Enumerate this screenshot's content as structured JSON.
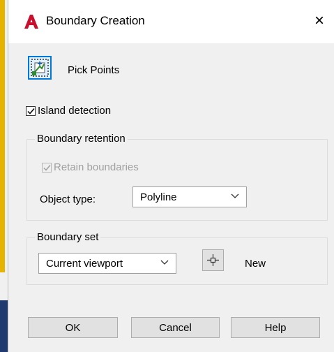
{
  "window": {
    "title": "Boundary Creation",
    "close_glyph": "×",
    "logo_letter": "A",
    "logo_color": "#c8102e"
  },
  "pick_points": {
    "label": "Pick Points",
    "icon": "pick-points-icon"
  },
  "island_detection": {
    "label": "Island detection",
    "checked": true
  },
  "boundary_retention": {
    "title": "Boundary retention",
    "retain": {
      "label": "Retain boundaries",
      "checked": true,
      "enabled": false
    },
    "object_type": {
      "label": "Object type:",
      "value": "Polyline"
    }
  },
  "boundary_set": {
    "title": "Boundary set",
    "select_value": "Current viewport",
    "new_label": "New"
  },
  "buttons": {
    "ok": "OK",
    "cancel": "Cancel",
    "help": "Help"
  },
  "colors": {
    "accent": "#0078d7",
    "disabled_text": "#a0a0a0",
    "side_yellow": "#e6b400",
    "side_blue": "#1f3a6e"
  }
}
